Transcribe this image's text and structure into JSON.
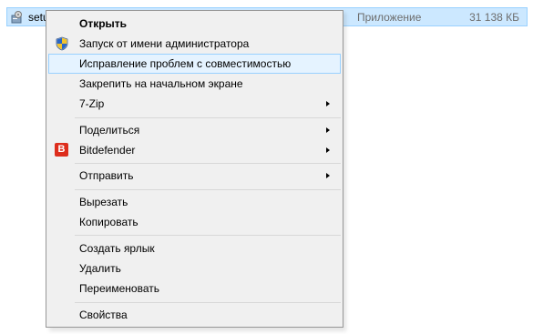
{
  "file": {
    "name": "setup",
    "type": "Приложение",
    "size": "31 138 КБ",
    "icon": "installer-icon"
  },
  "menu": {
    "open": "Открыть",
    "run_as_admin": "Запуск от имени администратора",
    "troubleshoot": "Исправление проблем с совместимостью",
    "pin_start": "Закрепить на начальном экране",
    "seven_zip": "7-Zip",
    "share": "Поделиться",
    "bitdefender": "Bitdefender",
    "bitdefender_icon_letter": "B",
    "send_to": "Отправить",
    "cut": "Вырезать",
    "copy": "Копировать",
    "create_shortcut": "Создать ярлык",
    "delete": "Удалить",
    "rename": "Переименовать",
    "properties": "Свойства"
  },
  "colors": {
    "selection_bg": "#cce8ff",
    "selection_border": "#99d1ff",
    "menu_bg": "#f0f0f0",
    "bitdefender_red": "#dd2d1c"
  }
}
